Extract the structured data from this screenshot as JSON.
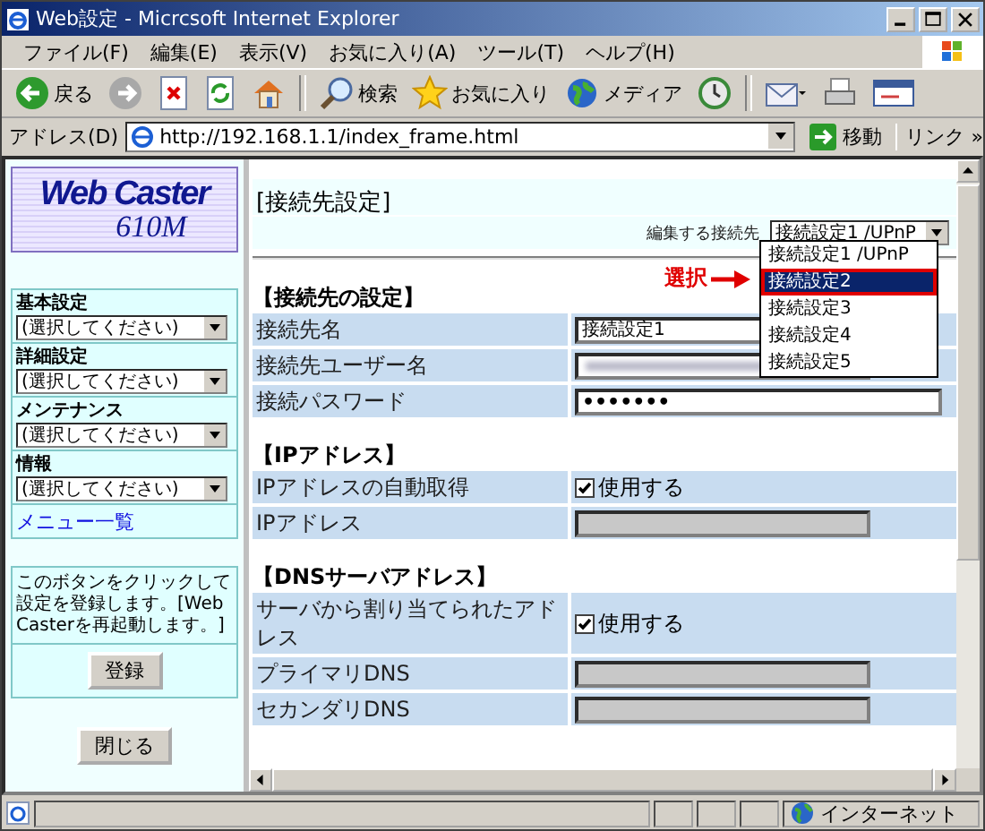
{
  "window": {
    "title": "Web設定 - Micrcsoft Internet Explorer"
  },
  "menu_bar": [
    "ファイル(F)",
    "編集(E)",
    "表示(V)",
    "お気に入り(A)",
    "ツール(T)",
    "ヘルプ(H)"
  ],
  "toolbar": [
    {
      "kind": "back",
      "label": "戻る"
    },
    {
      "kind": "forward"
    },
    {
      "kind": "stop"
    },
    {
      "kind": "refresh"
    },
    {
      "kind": "home"
    },
    {
      "kind": "search",
      "label": "検索"
    },
    {
      "kind": "favorites",
      "label": "お気に入り"
    },
    {
      "kind": "media",
      "label": "メディア"
    },
    {
      "kind": "history"
    },
    {
      "kind": "mail"
    },
    {
      "kind": "print"
    },
    {
      "kind": "edit"
    }
  ],
  "address_bar": {
    "label": "アドレス(D)",
    "url": "http://192.168.1.1/index_frame.html",
    "go": "移動",
    "links": "リンク",
    "more": "»"
  },
  "sidebar": {
    "logo": [
      "Web Caster",
      "610M"
    ],
    "menus": [
      {
        "label": "基本設定",
        "value": "(選択してください)"
      },
      {
        "label": "詳細設定",
        "value": "(選択してください)"
      },
      {
        "label": "メンテナンス",
        "value": "(選択してください)"
      },
      {
        "label": "情報",
        "value": "(選択してください)"
      }
    ],
    "menu_link": "メニュー一覧",
    "note": "このボタンをクリックして設定を登録します。[Web Casterを再起動します。]",
    "register_button": "登録",
    "close_button": "閉じる"
  },
  "main": {
    "title": "[接続先設定]",
    "edit_label": "編集する接続先",
    "select_value": "接続設定1 /UPnP",
    "options": [
      {
        "label": "接続設定1 /UPnP",
        "selected": false
      },
      {
        "label": "接続設定2",
        "selected": true
      },
      {
        "label": "接続設定3",
        "selected": false
      },
      {
        "label": "接続設定4",
        "selected": false
      },
      {
        "label": "接続設定5",
        "selected": false
      }
    ],
    "annotation": "選択",
    "sections": [
      {
        "heading": "【接続先の設定】",
        "rows": [
          {
            "label": "接続先名",
            "kind": "text",
            "value": "接続設定1"
          },
          {
            "label": "接続先ユーザー名",
            "kind": "blurred"
          },
          {
            "label": "接続パスワード",
            "kind": "password",
            "value": "•••••••"
          }
        ]
      },
      {
        "heading": "【IPアドレス】",
        "rows": [
          {
            "label": "IPアドレスの自動取得",
            "kind": "checkbox",
            "checked": true,
            "value": "使用する"
          },
          {
            "label": "IPアドレス",
            "kind": "disabled"
          }
        ]
      },
      {
        "heading": "【DNSサーバアドレス】",
        "rows": [
          {
            "label": "サーバから割り当てられたアドレス",
            "kind": "checkbox",
            "checked": true,
            "value": "使用する"
          },
          {
            "label": "プライマリDNS",
            "kind": "disabled"
          },
          {
            "label": "セカンダリDNS",
            "kind": "disabled"
          }
        ]
      }
    ]
  },
  "status_bar": {
    "zone": "インターネット"
  }
}
